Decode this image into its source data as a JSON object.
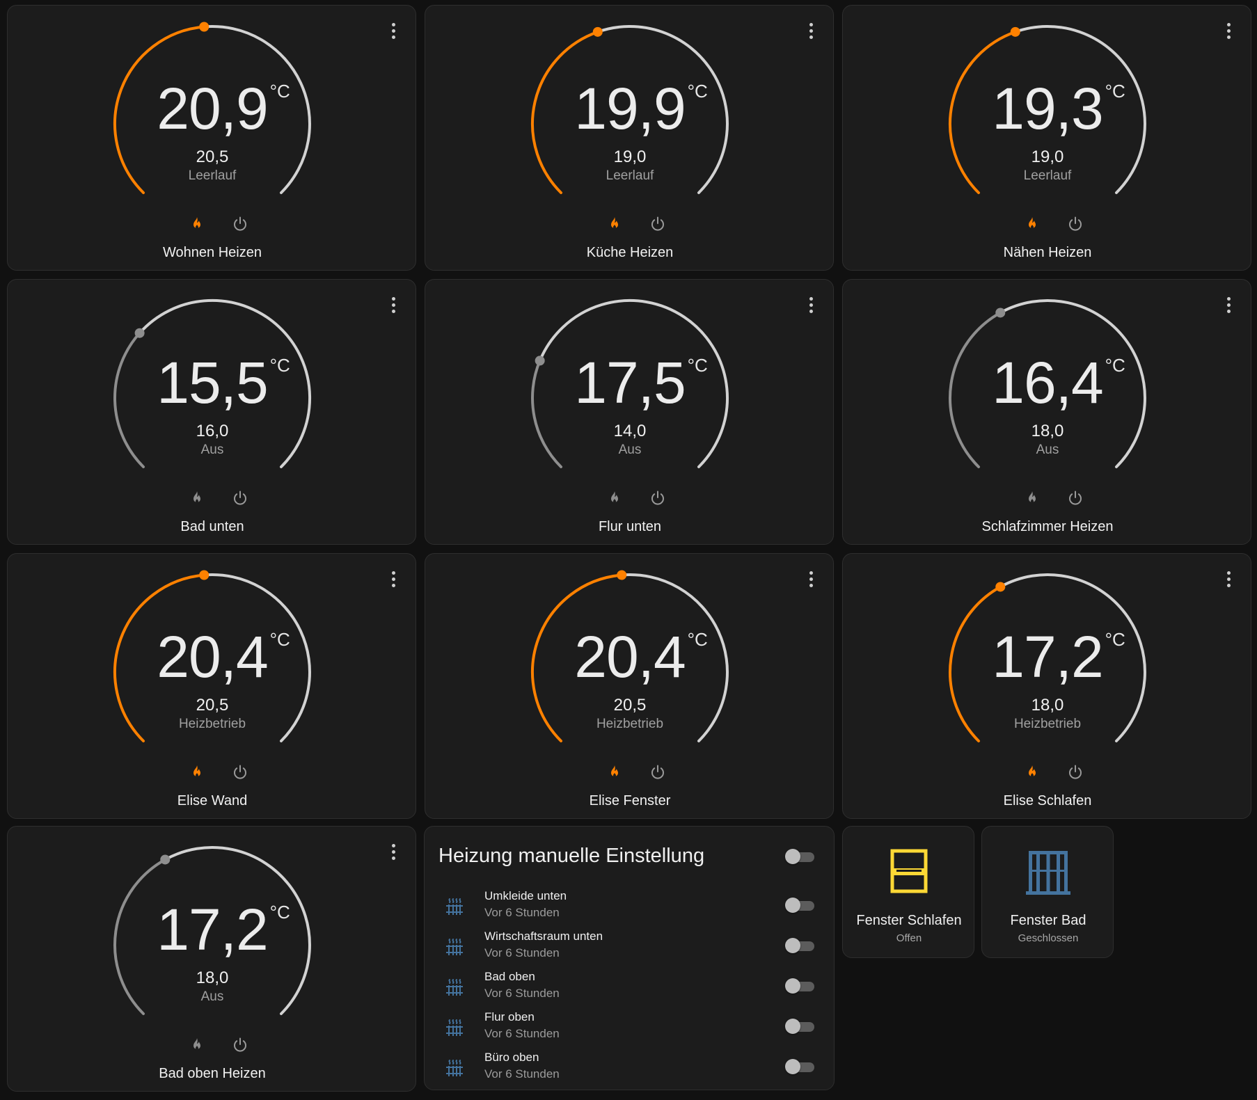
{
  "colors": {
    "background": "#111111",
    "card": "#1c1c1c",
    "heat_active": "#ff8100",
    "inactive": "#8e8e8e",
    "arc_track": "#d2d2d2",
    "window_open": "#fdd835",
    "window_closed": "#44739e"
  },
  "thermostats": [
    {
      "name": "Wohnen Heizen",
      "current": "20,9",
      "target": "20,5",
      "action": "Leerlauf",
      "unit": "°C",
      "target_value": 20.5,
      "active": true
    },
    {
      "name": "Küche Heizen",
      "current": "19,9",
      "target": "19,0",
      "action": "Leerlauf",
      "unit": "°C",
      "target_value": 19.0,
      "active": true
    },
    {
      "name": "Nähen Heizen",
      "current": "19,3",
      "target": "19,0",
      "action": "Leerlauf",
      "unit": "°C",
      "target_value": 19.0,
      "active": true
    },
    {
      "name": "Bad unten",
      "current": "15,5",
      "target": "16,0",
      "action": "Aus",
      "unit": "°C",
      "target_value": 16.0,
      "active": false
    },
    {
      "name": "Flur unten",
      "current": "17,5",
      "target": "14,0",
      "action": "Aus",
      "unit": "°C",
      "target_value": 14.0,
      "active": false
    },
    {
      "name": "Schlafzimmer Heizen",
      "current": "16,4",
      "target": "18,0",
      "action": "Aus",
      "unit": "°C",
      "target_value": 18.0,
      "active": false
    },
    {
      "name": "Elise Wand",
      "current": "20,4",
      "target": "20,5",
      "action": "Heizbetrieb",
      "unit": "°C",
      "target_value": 20.5,
      "active": true
    },
    {
      "name": "Elise Fenster",
      "current": "20,4",
      "target": "20,5",
      "action": "Heizbetrieb",
      "unit": "°C",
      "target_value": 20.5,
      "active": true
    },
    {
      "name": "Elise Schlafen",
      "current": "17,2",
      "target": "18,0",
      "action": "Heizbetrieb",
      "unit": "°C",
      "target_value": 18.0,
      "active": true
    },
    {
      "name": "Bad oben Heizen",
      "current": "17,2",
      "target": "18,0",
      "action": "Aus",
      "unit": "°C",
      "target_value": 18.0,
      "active": false
    }
  ],
  "manual": {
    "title": "Heizung manuelle Einstellung",
    "master_on": false,
    "items": [
      {
        "name": "Umkleide unten",
        "sub": "Vor 6 Stunden",
        "icon": "radiator-icon",
        "on": false
      },
      {
        "name": "Wirtschaftsraum unten",
        "sub": "Vor 6 Stunden",
        "icon": "radiator-icon",
        "on": false
      },
      {
        "name": "Bad oben",
        "sub": "Vor 6 Stunden",
        "icon": "radiator-icon",
        "on": false
      },
      {
        "name": "Flur oben",
        "sub": "Vor 6 Stunden",
        "icon": "radiator-icon",
        "on": false
      },
      {
        "name": "Büro oben",
        "sub": "Vor 6 Stunden",
        "icon": "radiator-icon",
        "on": false
      }
    ]
  },
  "windows": [
    {
      "name": "Fenster Schlafen",
      "state": "Offen",
      "icon": "window-open-icon"
    },
    {
      "name": "Fenster Bad",
      "state": "Geschlossen",
      "icon": "window-closed-icon"
    }
  ]
}
